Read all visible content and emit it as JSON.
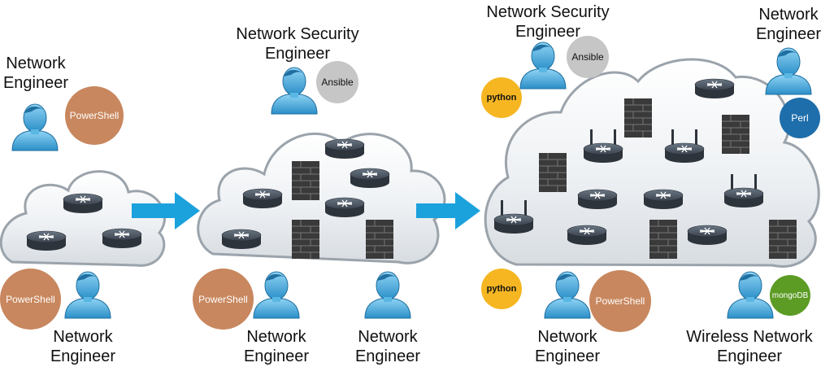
{
  "labels": {
    "stage1_engineer_top": [
      "Network",
      "Engineer"
    ],
    "stage1_engineer_bottom": [
      "Network",
      "Engineer"
    ],
    "stage2_security": [
      "Network Security",
      "Engineer"
    ],
    "stage2_engineer_a": [
      "Network",
      "Engineer"
    ],
    "stage2_engineer_b": [
      "Network",
      "Engineer"
    ],
    "stage3_security": [
      "Network Security",
      "Engineer"
    ],
    "stage3_engineer_top": [
      "Network",
      "Engineer"
    ],
    "stage3_engineer_bottom": [
      "Network",
      "Engineer"
    ],
    "stage3_wireless": [
      "Wireless Network",
      "Engineer"
    ]
  },
  "badges": {
    "powershell": "PowerShell",
    "ansible": "Ansible",
    "python": "python",
    "perl": "Perl",
    "mongodb": "mongoDB"
  },
  "colors": {
    "arrow": "#1ba1dc",
    "person": "#3fa8dc",
    "powershell": "#c8875e",
    "ansible": "#c6c6c6",
    "python": "#f5b622",
    "perl": "#1e6eab",
    "mongodb": "#5c9b24",
    "firewall": "#3a3a3a",
    "router": "#3d4550"
  },
  "icons": [
    "person-icon",
    "router-icon",
    "wireless-router-icon",
    "firewall-icon",
    "cloud-icon",
    "arrow-right-icon"
  ]
}
